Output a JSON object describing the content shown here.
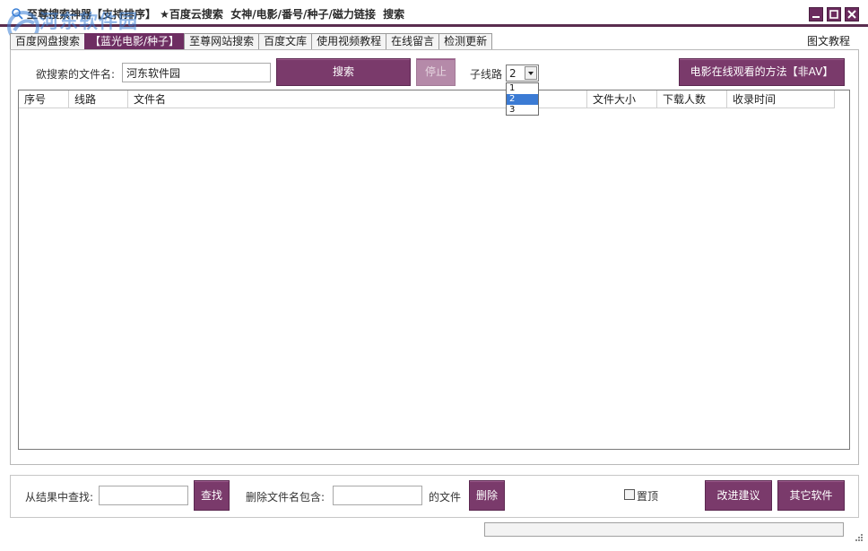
{
  "window": {
    "title": "至尊搜索神器【支持排序】 ★百度云搜索  女神/电影/番号/种子/磁力链接  搜索",
    "controls": [
      "minimize-icon",
      "maximize-icon",
      "close-icon"
    ]
  },
  "watermark": {
    "text": "河东软件园",
    "url": "www.pc0359.cn"
  },
  "tabs": [
    {
      "label": "百度网盘搜索",
      "active": false
    },
    {
      "label": "【蓝光电影/种子】",
      "active": true
    },
    {
      "label": "至尊网站搜索",
      "active": false
    },
    {
      "label": "百度文库",
      "active": false
    },
    {
      "label": "使用视频教程",
      "active": false
    },
    {
      "label": "在线留言",
      "active": false
    },
    {
      "label": "检测更新",
      "active": false
    }
  ],
  "help_link": "图文教程",
  "search": {
    "label": "欲搜索的文件名:",
    "value": "河东软件园",
    "search_button": "搜索",
    "stop_button": "停止",
    "subline_label": "子线路",
    "subline_value": "2",
    "subline_options": [
      "1",
      "2",
      "3"
    ],
    "movie_button": "电影在线观看的方法【非AV】"
  },
  "table": {
    "columns": [
      "序号",
      "线路",
      "文件名",
      "文件大小",
      "下载人数",
      "收录时间"
    ],
    "rows": []
  },
  "footer": {
    "find_label": "从结果中查找:",
    "find_value": "",
    "find_button": "查找",
    "delete_label": "删除文件名包含:",
    "delete_value": "",
    "delete_suffix": "的文件",
    "delete_button": "删除",
    "pin_label": "置顶",
    "pin_checked": false,
    "suggest_button": "改进建议",
    "other_button": "其它软件"
  },
  "colors": {
    "accent": "#7a3a6b",
    "title_border": "#5a2d4f",
    "selection": "#3b7bd4"
  }
}
